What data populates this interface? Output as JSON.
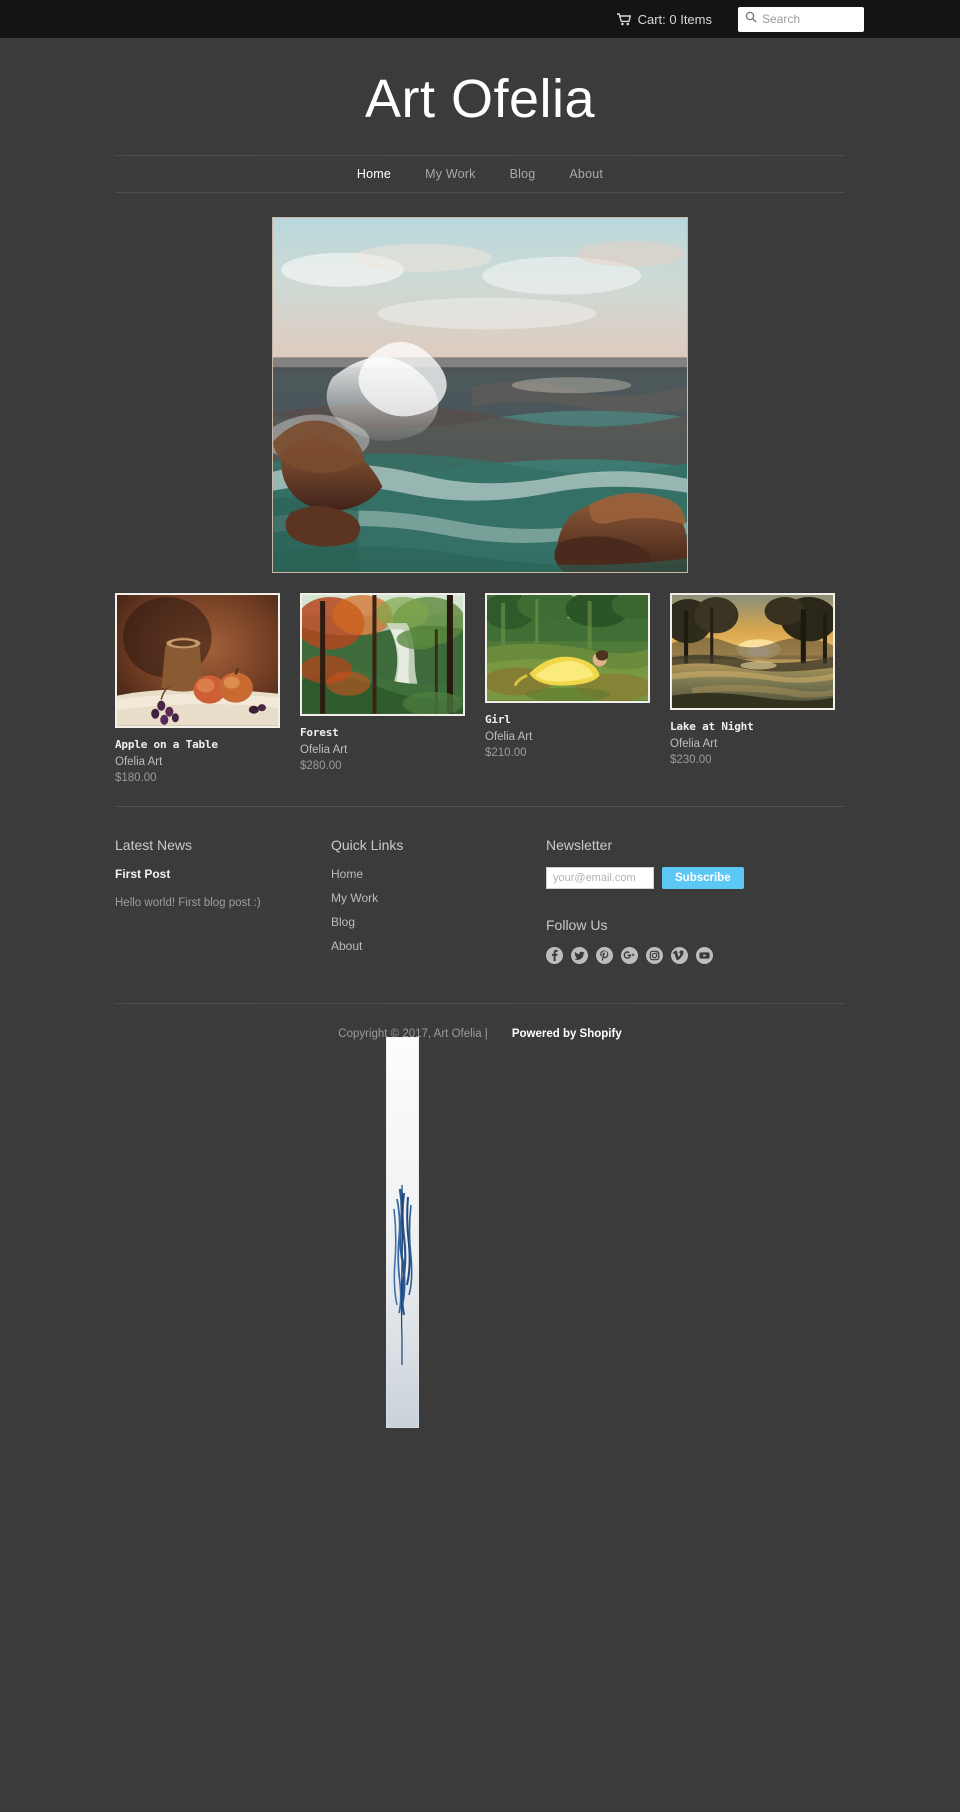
{
  "topbar": {
    "cart_label": "Cart: 0 Items",
    "cart_icon": "shopping-cart-icon",
    "search_placeholder": "Search",
    "search_value": "",
    "search_icon": "search-icon"
  },
  "header": {
    "site_title": "Art Ofelia"
  },
  "nav": {
    "items": [
      {
        "label": "Home",
        "active": true
      },
      {
        "label": "My Work",
        "active": false
      },
      {
        "label": "Blog",
        "active": false
      },
      {
        "label": "About",
        "active": false
      }
    ]
  },
  "hero": {
    "alt": "Seascape painting of waves crashing on rocky coast"
  },
  "products": [
    {
      "title": "Apple on a Table",
      "vendor": "Ofelia Art",
      "price": "$180.00",
      "alt": "Still life with jug, apples and grapes"
    },
    {
      "title": "Forest",
      "vendor": "Ofelia Art",
      "price": "$280.00",
      "alt": "Autumn forest with a stream"
    },
    {
      "title": "Girl",
      "vendor": "Ofelia Art",
      "price": "$210.00",
      "alt": "Girl in yellow dress lying in a meadow"
    },
    {
      "title": "Lake at Night",
      "vendor": "Ofelia Art",
      "price": "$230.00",
      "alt": "Lake at sunset with trees"
    }
  ],
  "footer": {
    "news": {
      "heading": "Latest News",
      "post_title": "First Post",
      "excerpt": "Hello world! First blog post :)"
    },
    "quick_links": {
      "heading": "Quick Links",
      "items": [
        "Home",
        "My Work",
        "Blog",
        "About"
      ]
    },
    "newsletter": {
      "heading": "Newsletter",
      "email_placeholder": "your@email.com",
      "email_value": "",
      "subscribe_label": "Subscribe"
    },
    "follow": {
      "heading": "Follow Us",
      "icons": [
        "facebook-icon",
        "twitter-icon",
        "pinterest-icon",
        "google-plus-icon",
        "instagram-icon",
        "vimeo-icon",
        "youtube-icon"
      ]
    },
    "copyright": "Copyright © 2017, Art Ofelia |",
    "powered_by": "Powered by Shopify"
  },
  "colors": {
    "page_bg": "#3a3a3a",
    "topbar_bg": "#141414",
    "accent_blue": "#5bc8f5",
    "text_light": "#ffffff",
    "text_muted": "#9b9b9b"
  }
}
